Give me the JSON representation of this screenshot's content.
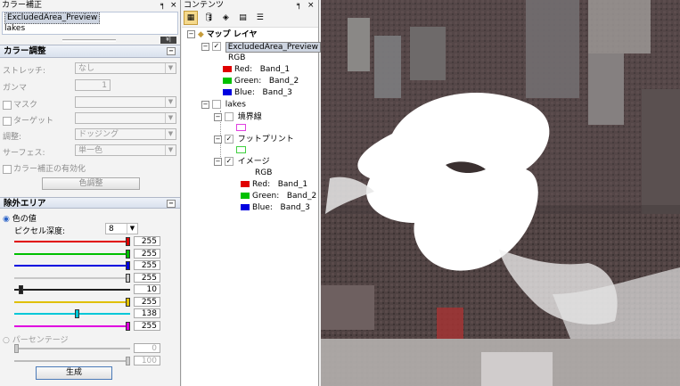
{
  "left_panel": {
    "title": "カラー補正",
    "layers": [
      "ExcludedArea_Preview",
      "lakes"
    ],
    "color_section": {
      "title": "カラー調整",
      "stretch_label": "ストレッチ:",
      "stretch_value": "なし",
      "gamma_label": "ガンマ",
      "gamma_value": "1",
      "mask_label": "マスク",
      "target_label": "ターゲット",
      "adjust_label": "調整:",
      "adjust_value": "ドッジング",
      "surface_label": "サーフェス:",
      "surface_value": "単一色",
      "enable_label": "カラー補正の有効化",
      "button_label": "色調整"
    },
    "exclude_section": {
      "title": "除外エリア",
      "color_value_label": "色の値",
      "pixel_depth_label": "ピクセル深度:",
      "pixel_depth_value": "8",
      "sliders": [
        {
          "color": "#e00000",
          "value": "255",
          "fraction": 1.0
        },
        {
          "color": "#00c000",
          "value": "255",
          "fraction": 1.0
        },
        {
          "color": "#0000e0",
          "value": "255",
          "fraction": 1.0
        },
        {
          "color": "#c8c8c8",
          "value": "255",
          "fraction": 1.0
        },
        {
          "color": "#202020",
          "value": "10",
          "fraction": 0.04
        },
        {
          "color": "#e0c000",
          "value": "255",
          "fraction": 1.0
        },
        {
          "color": "#00c8d8",
          "value": "138",
          "fraction": 0.54
        },
        {
          "color": "#e000e0",
          "value": "255",
          "fraction": 1.0
        }
      ],
      "percentage_label": "パーセンテージ",
      "pct_low": "0",
      "pct_high": "100",
      "generate_button": "生成"
    }
  },
  "toc": {
    "title": "コンテンツ",
    "map_layer": "マップ レイヤ",
    "excluded_layer": "ExcludedArea_Preview",
    "rgb": "RGB",
    "bands": [
      {
        "label": "Red:",
        "band": "Band_1",
        "color": "#e00000"
      },
      {
        "label": "Green:",
        "band": "Band_2",
        "color": "#00c000"
      },
      {
        "label": "Blue:",
        "band": "Band_3",
        "color": "#0000e0"
      }
    ],
    "lakes": "lakes",
    "boundary": "境界線",
    "footprint": "フットプリント",
    "image": "イメージ",
    "rgb2": "RGB",
    "bands2": [
      {
        "label": "Red:",
        "band": "Band_1",
        "color": "#e00000"
      },
      {
        "label": "Green:",
        "band": "Band_2",
        "color": "#00c000"
      },
      {
        "label": "Blue:",
        "band": "Band_3",
        "color": "#0000e0"
      }
    ]
  },
  "glyphs": {
    "pin": "📌",
    "close": "×",
    "check": "✓",
    "minus": "−",
    "plus": "+",
    "dropdown": "▼",
    "radio": "◉"
  }
}
